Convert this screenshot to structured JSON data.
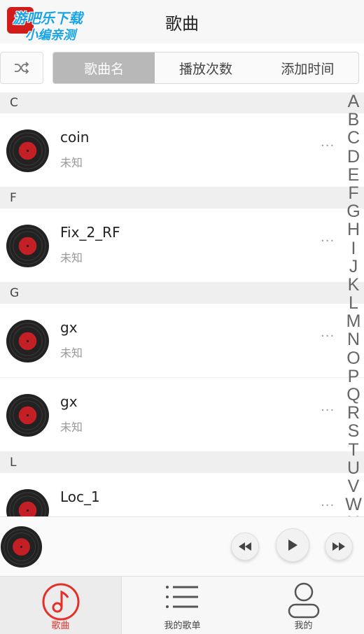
{
  "header": {
    "title": "歌曲",
    "watermark_line1": "游吧乐下载",
    "watermark_line2": "小编亲测"
  },
  "sortbar": {
    "shuffle_icon": "shuffle-icon",
    "tabs": [
      "歌曲名",
      "播放次数",
      "添加时间"
    ],
    "active_tab": "歌曲名"
  },
  "sections": [
    {
      "letter": "C",
      "songs": [
        {
          "title": "coin",
          "artist": "未知"
        }
      ]
    },
    {
      "letter": "F",
      "songs": [
        {
          "title": "Fix_2_RF",
          "artist": "未知"
        }
      ]
    },
    {
      "letter": "G",
      "songs": [
        {
          "title": "gx",
          "artist": "未知"
        },
        {
          "title": "gx",
          "artist": "未知"
        }
      ]
    },
    {
      "letter": "L",
      "songs": [
        {
          "title": "Loc_1",
          "artist": "未知"
        }
      ]
    }
  ],
  "more_label": "···",
  "alphabet": [
    "A",
    "B",
    "C",
    "D",
    "E",
    "F",
    "G",
    "H",
    "I",
    "J",
    "K",
    "L",
    "M",
    "N",
    "O",
    "P",
    "Q",
    "R",
    "S",
    "T",
    "U",
    "V",
    "W",
    "X"
  ],
  "player": {
    "prev_icon": "rewind-icon",
    "play_icon": "play-icon",
    "next_icon": "fast-forward-icon"
  },
  "tabs": [
    {
      "label": "歌曲",
      "icon": "music-note-icon",
      "active": true
    },
    {
      "label": "我的歌单",
      "icon": "list-icon",
      "active": false
    },
    {
      "label": "我的",
      "icon": "user-icon",
      "active": false
    }
  ],
  "colors": {
    "accent": "#e5302a",
    "disc_label": "#c41f24",
    "watermark": "#16a3e8"
  }
}
